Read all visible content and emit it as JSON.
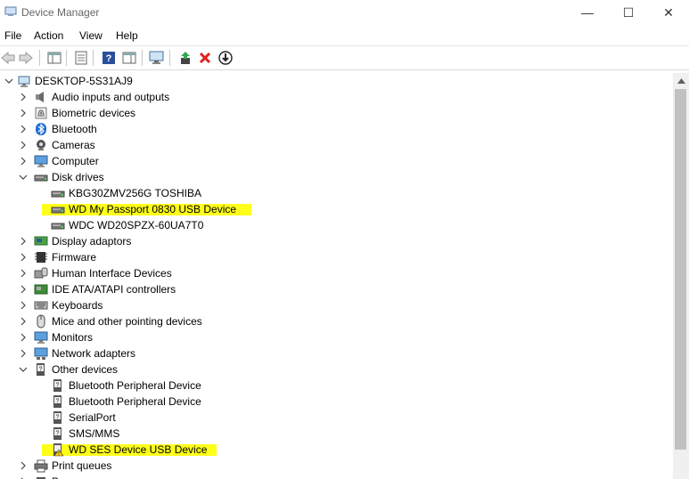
{
  "window": {
    "title": "Device Manager",
    "minimize": "—",
    "maximize": "☐",
    "close": "✕"
  },
  "menu": [
    "File",
    "Action",
    "View",
    "Help"
  ],
  "toolbar": {
    "icons": [
      "back-arrow-icon",
      "forward-arrow-icon",
      "show-hide-tree-icon",
      "properties-icon",
      "help-icon",
      "action-pane-icon",
      "scan-hardware-icon",
      "update-driver-icon",
      "uninstall-device-icon",
      "disable-device-icon"
    ]
  },
  "tree": {
    "root": "DESKTOP-5S31AJ9",
    "rows": [
      {
        "label": "Audio inputs and outputs",
        "icon": "speaker-icon",
        "expanded": false
      },
      {
        "label": "Biometric devices",
        "icon": "fingerprint-icon",
        "expanded": false
      },
      {
        "label": "Bluetooth",
        "icon": "bluetooth-icon",
        "expanded": false
      },
      {
        "label": "Cameras",
        "icon": "camera-icon",
        "expanded": false
      },
      {
        "label": "Computer",
        "icon": "monitor-icon",
        "expanded": false
      },
      {
        "label": "Disk drives",
        "icon": "disk-drive-icon",
        "expanded": true
      },
      {
        "label": "KBG30ZMV256G TOSHIBA",
        "icon": "disk-drive-icon",
        "child": true
      },
      {
        "label": "WD My Passport 0830 USB Device",
        "icon": "disk-drive-icon",
        "child": true,
        "highlight": true
      },
      {
        "label": "WDC WD20SPZX-60UA7T0",
        "icon": "disk-drive-icon",
        "child": true
      },
      {
        "label": "Display adaptors",
        "icon": "display-adapter-icon",
        "expanded": false
      },
      {
        "label": "Firmware",
        "icon": "chip-icon",
        "expanded": false
      },
      {
        "label": "Human Interface Devices",
        "icon": "hid-icon",
        "expanded": false
      },
      {
        "label": "IDE ATA/ATAPI controllers",
        "icon": "controller-icon",
        "expanded": false
      },
      {
        "label": "Keyboards",
        "icon": "keyboard-icon",
        "expanded": false
      },
      {
        "label": "Mice and other pointing devices",
        "icon": "mouse-icon",
        "expanded": false
      },
      {
        "label": "Monitors",
        "icon": "monitor-icon",
        "expanded": false
      },
      {
        "label": "Network adapters",
        "icon": "network-icon",
        "expanded": false
      },
      {
        "label": "Other devices",
        "icon": "unknown-device-icon",
        "expanded": true
      },
      {
        "label": "Bluetooth Peripheral Device",
        "icon": "unknown-device-icon",
        "child": true
      },
      {
        "label": "Bluetooth Peripheral Device",
        "icon": "unknown-device-icon",
        "child": true
      },
      {
        "label": "SerialPort",
        "icon": "unknown-device-icon",
        "child": true
      },
      {
        "label": "SMS/MMS",
        "icon": "unknown-device-icon",
        "child": true
      },
      {
        "label": "WD SES Device USB Device",
        "icon": "warning-device-icon",
        "child": true,
        "highlight": true
      },
      {
        "label": "Print queues",
        "icon": "printer-icon",
        "expanded": false
      },
      {
        "label": "P",
        "icon": "processor-icon",
        "expanded": false
      }
    ]
  },
  "colors": {
    "highlight": "#ffff1a",
    "accent": "#0078d7"
  }
}
